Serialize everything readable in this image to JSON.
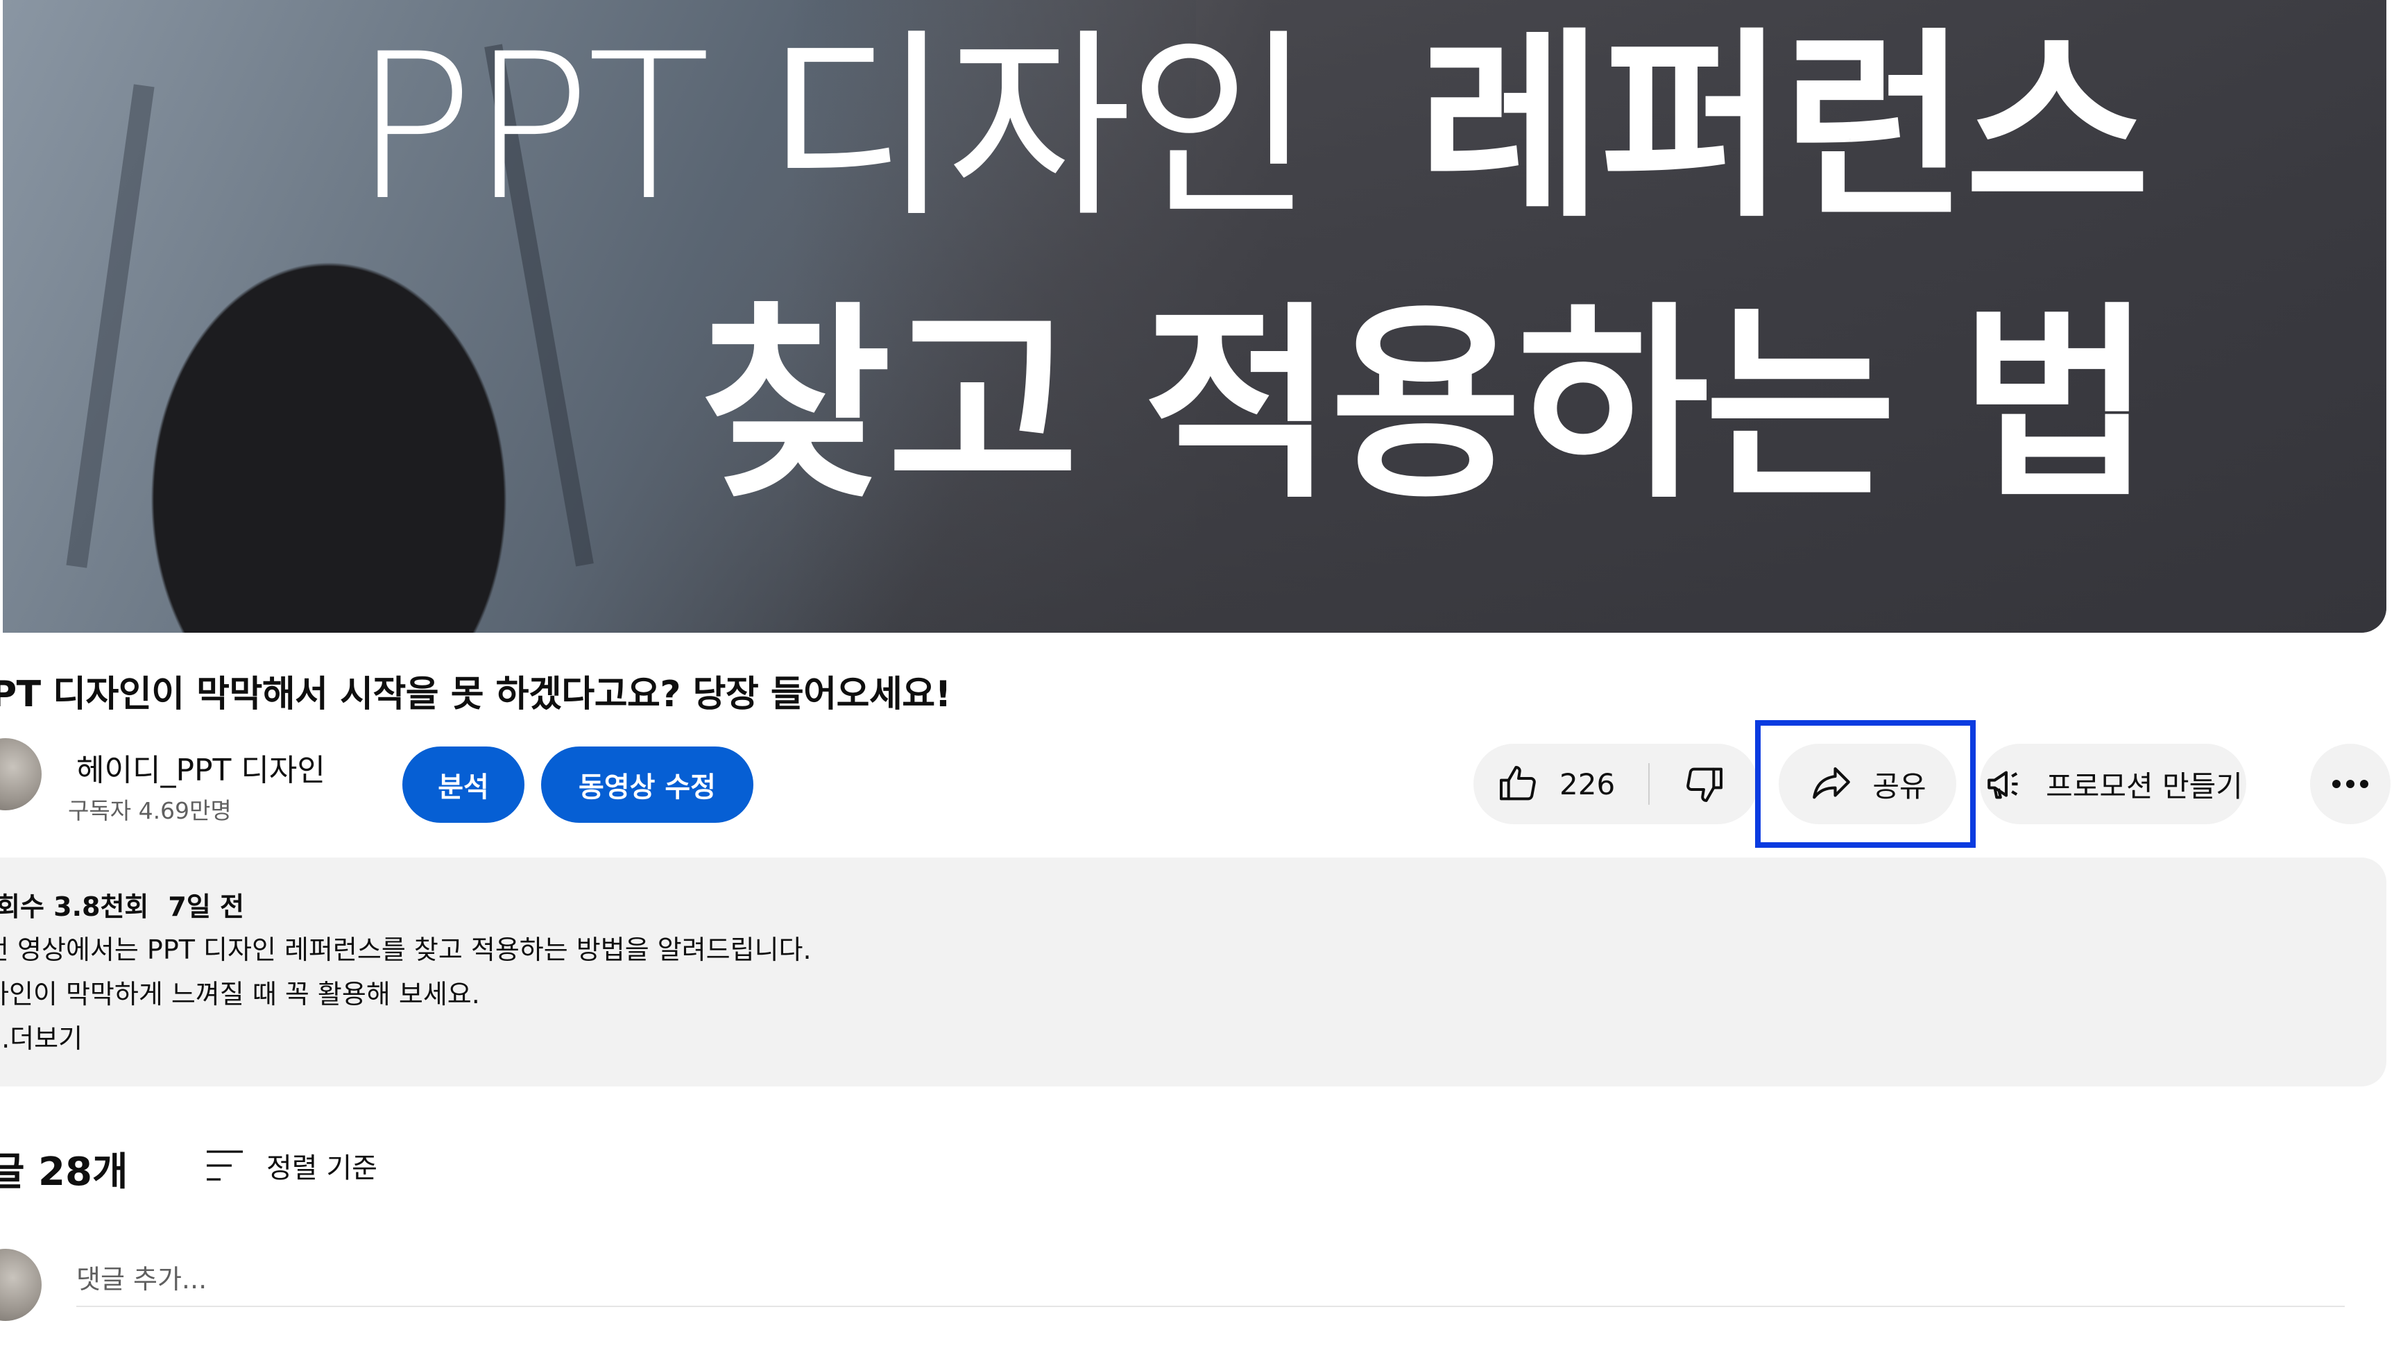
{
  "thumbnail": {
    "line1_light": "PPT 디자인",
    "line1_bold": "레퍼런스",
    "line2": "찾고 적용하는 법"
  },
  "video": {
    "title": "PT 디자인이 막막해서 시작을 못 하겠다고요? 당장 들어오세요!"
  },
  "channel": {
    "name": "헤이디_PPT 디자인",
    "subscribers": "구독자 4.69만명"
  },
  "buttons": {
    "analytics": "분석",
    "edit_video": "동영상 수정",
    "like_count": "226",
    "share": "공유",
    "promote": "프로모션 만들기"
  },
  "description": {
    "views": "회수 3.8천회",
    "date": "7일 전",
    "line1": "번 영상에서는 PPT 디자인 레퍼런스를 찾고 적용하는 방법을 알려드립니다.",
    "line2": "자인이 막막하게 느껴질 때 꼭 활용해 보세요.",
    "more": "..더보기"
  },
  "comments": {
    "count": "글 28개",
    "sort_label": "정렬 기준",
    "input_placeholder": "댓글 추가..."
  },
  "colors": {
    "primary_button": "#065fd4",
    "highlight_box": "#0a3be0",
    "chip_background": "#f2f2f2"
  },
  "icons": [
    "thumbs-up-icon",
    "thumbs-down-icon",
    "share-arrow-icon",
    "megaphone-icon",
    "more-horizontal-icon",
    "sort-icon"
  ]
}
